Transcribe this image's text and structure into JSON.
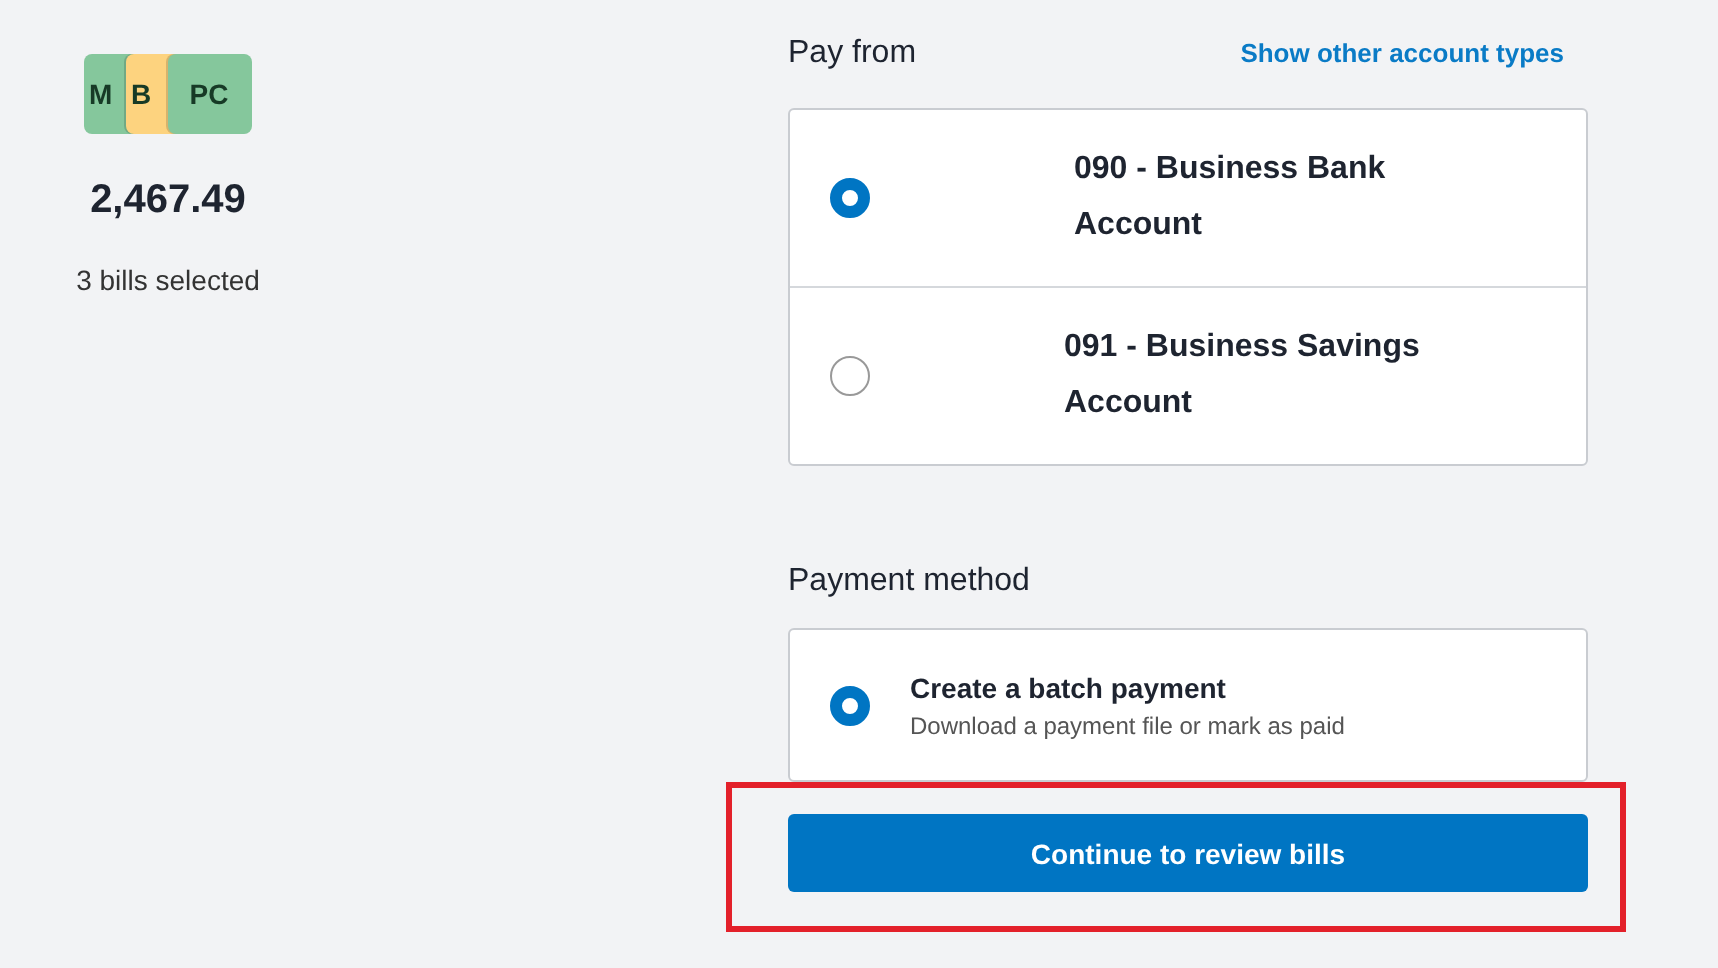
{
  "summary": {
    "avatars": [
      {
        "label": "M",
        "color": "#85c79c"
      },
      {
        "label": "B",
        "color": "#fdd37f"
      },
      {
        "label": "PC",
        "color": "#85c79c"
      }
    ],
    "amount": "2,467.49",
    "count": "3 bills selected"
  },
  "pay_from": {
    "title": "Pay from",
    "link": "Show other account types",
    "accounts": [
      {
        "name": "090 - Business Bank Account",
        "selected": true
      },
      {
        "name": "091 - Business Savings Account",
        "selected": false
      }
    ]
  },
  "payment_method": {
    "title": "Payment method",
    "options": [
      {
        "title": "Create a batch payment",
        "description": "Download a payment file or mark as paid",
        "selected": true
      }
    ]
  },
  "continue_button": {
    "label": "Continue to review bills",
    "highlighted": true
  }
}
